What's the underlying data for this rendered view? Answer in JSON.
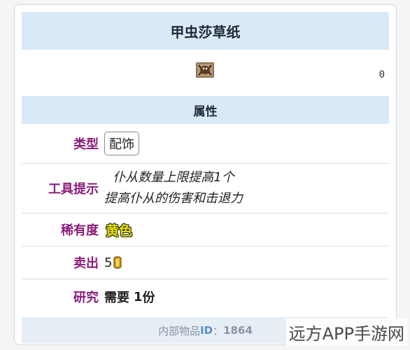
{
  "title": "甲虫莎草纸",
  "section_header": "属性",
  "corner_glyph": "0",
  "rows": [
    {
      "label": "类型",
      "label_color": "#8b1d7a",
      "value": "配饰"
    },
    {
      "label": "工具提示",
      "label_color": "#8b1d7a",
      "lines": [
        "仆从数量上限提高1个",
        "提高仆从的伤害和击退力"
      ]
    },
    {
      "label": "稀有度",
      "label_color": "#8b1d7a",
      "value": "黄色",
      "value_color": "#e8e400"
    },
    {
      "label": "卖出",
      "label_color": "#8b1d7a",
      "value": "5",
      "icon": "gold-coin-icon"
    },
    {
      "label": "研究",
      "label_color": "#8b1d7a",
      "value": "需要",
      "count": "1",
      "unit": "份"
    }
  ],
  "footer": {
    "prefix": "内部物品",
    "id_key": "ID",
    "separator": "：",
    "id_value": "1864"
  },
  "watermark": "远方APP手游网",
  "colors": {
    "header_bg": "#dae9f7",
    "label": "#8b1d7a",
    "research_value": "#8b1d7a"
  }
}
